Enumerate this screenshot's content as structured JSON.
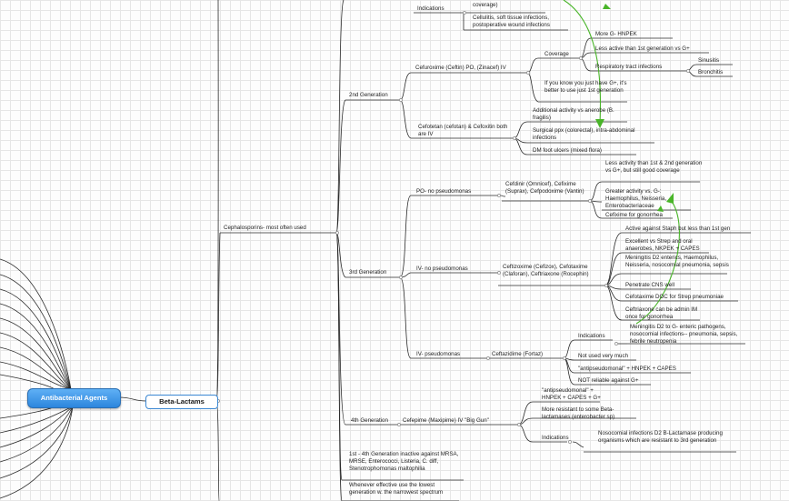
{
  "root_topic": "Antibacterial Agents",
  "main_topic": "Beta-Lactams",
  "cephalosporins": "Cephalosporins- most often used",
  "first_gen_tail": {
    "coverage_tail": "coverage)",
    "indications": "Indications",
    "indication_text": "Cellulitis, soft tissue infections, postoperative wound infections"
  },
  "second_gen": {
    "label": "2nd Generation",
    "cefuroxime": "Cefuroxime (Ceftin) PO, (Zinacef) IV",
    "coverage": "Coverage",
    "more_g": "More G- HNPEK",
    "less_active": "Less active than 1st generation vs G+",
    "respiratory": "Respiratory tract infections",
    "sinusitis": "Sinusitis",
    "bronchitis": "Bronchitis",
    "if_gplus": "If you know you just have G+, it's better to use just 1st generation",
    "cefotetan": "Cefotetan (cefotan) & Cefoxitin both are IV",
    "anaerobe": "Additional activity vs anerobe (B. fragilis)",
    "surgical": "Surgical ppx (colorectal), intra-abdominal infections",
    "dm_foot": "DM foot ulcers (mixed flora)"
  },
  "third_gen": {
    "label": "3rd Generation",
    "po_no_pseudo": "PO- no pseudomonas",
    "cefdinir": "Cefdinir (Omnicef), Cefixime (Suprax), Cefpodoxime (Vantin)",
    "less_activity": "Less activity than 1st & 2nd generation vs G+, but still good coverage",
    "greater_activity": "Greater activity vs. G-: Haemophilus, Neisseria, Enterobacteriaceae",
    "cefixime_gono": "Cefixime for gonorrhea",
    "iv_no_pseudo": "IV- no pseudomonas",
    "ceftizoxime": "Ceftizoxime (Cefizox), Cefotaxime (Claforan), Ceftriaxone (Rocephin)",
    "active_staph": "Active against Staph but less than 1st gen",
    "excellent_strep": "Excellent vs Strep and oral anaerobes, NKPEK + CAPES",
    "meningitis": "Meningitis D2 enterics, Haemophilus, Neisseria, nosocomial pneumonia, sepsis",
    "penetrate": "Penetrate CNS well",
    "cefotaxime_doc": "Cefotaxime DOC for Strep pneumoniae",
    "ceftriaxone_im": "Ceftriaxone can be admin IM once for gonorrhea",
    "iv_pseudo": "IV- pseudomonas",
    "ceftazidime": "Ceftazidime (Fortaz)",
    "indications": "Indications",
    "meningitis_g": "Meningitis D2 to G- enteric pathogens, nosocomial infections-- pneumonia, sepsis, febrile neutropenia",
    "not_used": "Not used very much",
    "antipseudomonal": "\"antipseudomonal\" + HNPEK + CAPES",
    "not_reliable": "NOT reliable against G+"
  },
  "fourth_gen": {
    "label": "4th Generation",
    "cefepime": "Cefepime (Maxipime) IV  \"Big Gun\"",
    "antipseudomonal": "\"antipseudomonal\" + HNPEK + CAPES + G+",
    "more_resistant": "More resistant to some Beta-lactamases (enterobacter sp)",
    "indications": "Indications",
    "nosocomial": "Nosocomial infections D2 B-Lactamase producing organisms which are resistant to 3rd generation"
  },
  "inactive_note": "1st - 4th Generation inactive against MRSA, MRSE, Enterococci, Listeria, C. diff, Stenotrophomonas maltophilia",
  "whenever_note": "Whenever effective use the lowest generation w. the narrowest spectrum",
  "colors": {
    "root": "#3f9ae8",
    "arrow": "#49b529",
    "line": "#2a2a2a",
    "grid": "#e6e6e6"
  }
}
